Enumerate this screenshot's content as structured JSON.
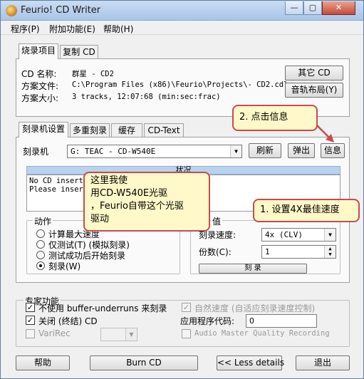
{
  "window": {
    "title": "Feurio! CD Writer",
    "minimize": "—",
    "maximize": "▢",
    "close": "✕"
  },
  "menu": [
    "程序(P)",
    "附加功能(E)",
    "帮助(H)"
  ],
  "project": {
    "tabs": [
      "烧录项目",
      "复制 CD"
    ],
    "cd_name_label": "CD 名称:",
    "cd_name": "群星 - CD2",
    "file_label": "方案文件:",
    "file": "C:\\Program Files (x86)\\Feurio\\Projects\\- CD2.cdl",
    "size_label": "方案大小:",
    "size": "3 tracks, 12:07:68 (min:sec:frac)",
    "other_cd_button": "其它 CD",
    "track_layout_button": "音轨布局(Y)"
  },
  "writer_tabs": [
    "刻录机设置",
    "多重刻录",
    "缓存",
    "CD-Text"
  ],
  "writer": {
    "label": "刻录机",
    "selected": "G:  TEAC - CD-W540E",
    "refresh_button": "刷新",
    "eject_button": "弹出",
    "info_button": "信息",
    "status_header": "状况",
    "status_lines": [
      "No CD inserte",
      "Please insert"
    ]
  },
  "action": {
    "title": "动作",
    "options": [
      "计算最大速度",
      "仅测试(T) (模拟刻录)",
      "测试成功后开始刻录",
      "刻录(W)"
    ],
    "selected_index": 3
  },
  "settings": {
    "title": "值",
    "speed_label": "刻录速度:",
    "speed_value": "4x (CLV)",
    "copies_label": "份数(C):",
    "copies_value": "1",
    "partial_button": "刻 录"
  },
  "expert": {
    "title": "专家功能",
    "no_buffer_underruns": "不使用 buffer-underruns 来刻录",
    "finalize": "关闭 (终结) CD",
    "varirec": "VariRec",
    "auto_speed": "自然速度 (自适应刻录速度控制)",
    "app_code_label": "应用程序代码:",
    "app_code": "0",
    "audio_master": "Audio Master Quality Recording"
  },
  "bottom": {
    "help": "帮助",
    "burn": "Burn CD",
    "less": "<< Less details",
    "exit": "退出"
  },
  "annotations": {
    "click_info": "2. 点击信息",
    "set_speed": "1. 设置4X最佳速度",
    "note_lines": [
      "这里我使",
      "用CD-W540E光驱",
      "，Feurio自带这个光驱",
      "驱动"
    ]
  },
  "colors": {
    "callout_border": "#c84a50",
    "callout_fill": "#fff8c8",
    "status_header": "#b9d3ee"
  }
}
